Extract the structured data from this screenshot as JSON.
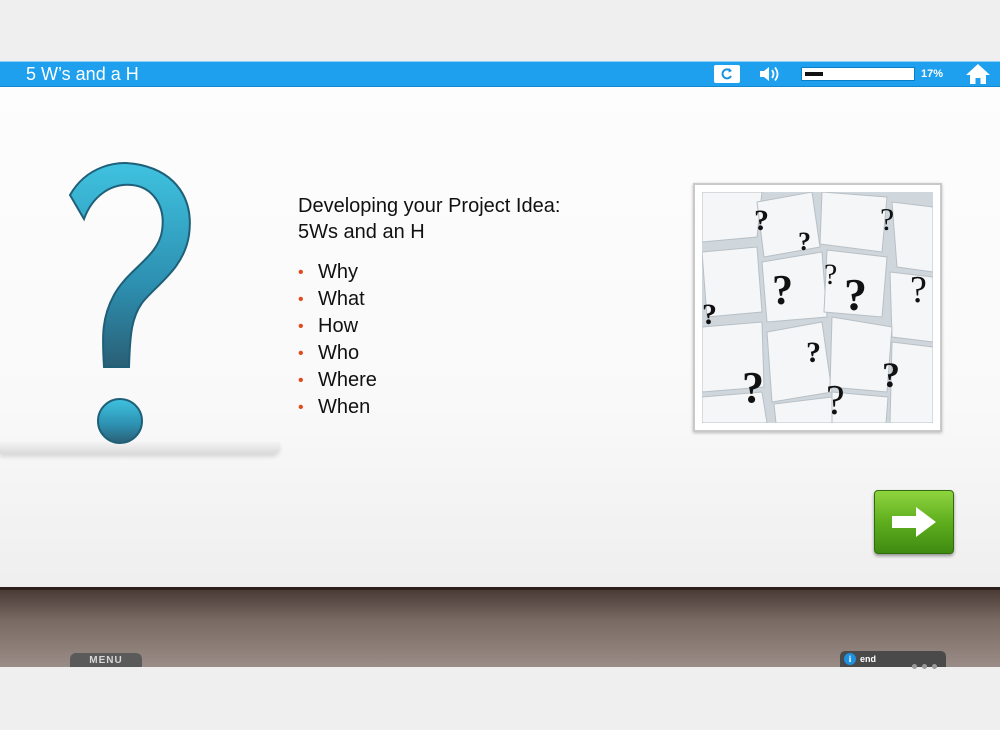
{
  "header": {
    "title": "5 W’s and a H",
    "progress_fraction": 0.17,
    "progress_text": "17%"
  },
  "content": {
    "heading_line1": "Developing your Project Idea:",
    "heading_line2": "5Ws and an H",
    "bullets": [
      "Why",
      "What",
      "How",
      "Who",
      "Where",
      "When"
    ]
  },
  "footer": {
    "menu_label": "MENU",
    "info_label": "end"
  },
  "icons": {
    "replay": "replay-icon",
    "volume": "speaker-icon",
    "home": "home-icon",
    "next": "right-arrow-icon",
    "info": "info-icon"
  },
  "colors": {
    "topbar": "#1ea0ee",
    "bullet": "#e04a1c",
    "next_button": "#5fae1e"
  }
}
